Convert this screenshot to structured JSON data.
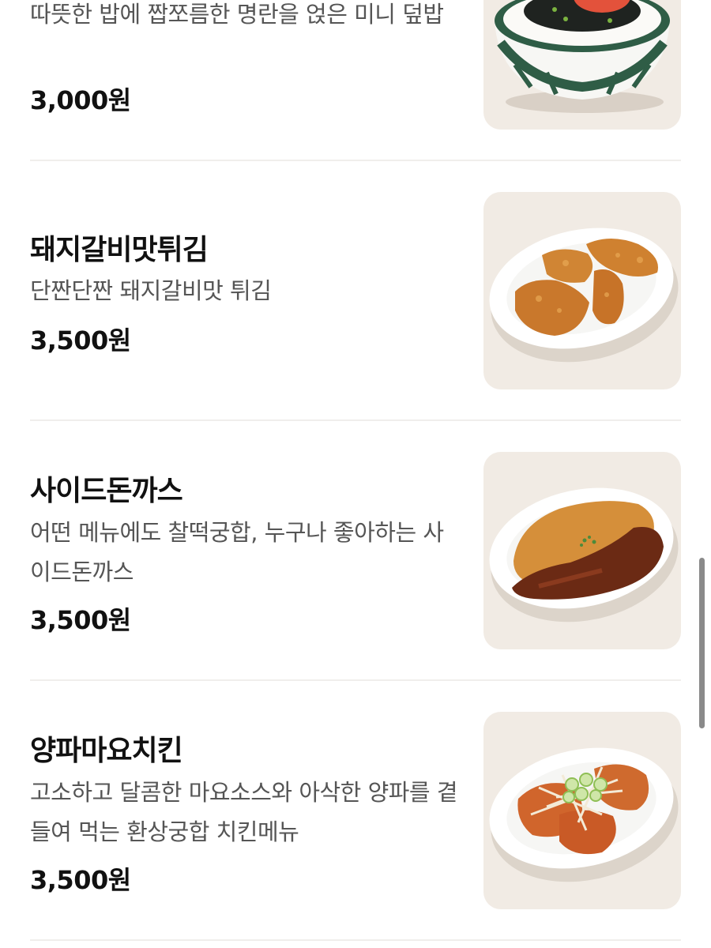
{
  "menu": {
    "items": [
      {
        "name": "",
        "description": "따뜻한 밥에 짭쪼름한 명란을 얹은 미니 덮밥",
        "price": "3,000원",
        "photo_icon": "mentaiko-rice-bowl-photo"
      },
      {
        "name": "돼지갈비맛튀김",
        "description": "단짠단짠 돼지갈비맛 튀김",
        "price": "3,500원",
        "photo_icon": "fried-pork-plate-photo"
      },
      {
        "name": "사이드돈까스",
        "description": "어떤 메뉴에도 찰떡궁합, 누구나 좋아하는 사이드돈까스",
        "price": "3,500원",
        "photo_icon": "pork-cutlet-plate-photo"
      },
      {
        "name": "양파마요치킨",
        "description": "고소하고 달콤한 마요소스와 아삭한 양파를 곁들여 먹는 환상궁합 치킨메뉴",
        "price": "3,500원",
        "photo_icon": "onion-mayo-chicken-plate-photo"
      }
    ]
  },
  "colors": {
    "photo_background": "#f1ebe4",
    "divider": "#f0eeec",
    "scrollbar": "#8a8a8a"
  }
}
